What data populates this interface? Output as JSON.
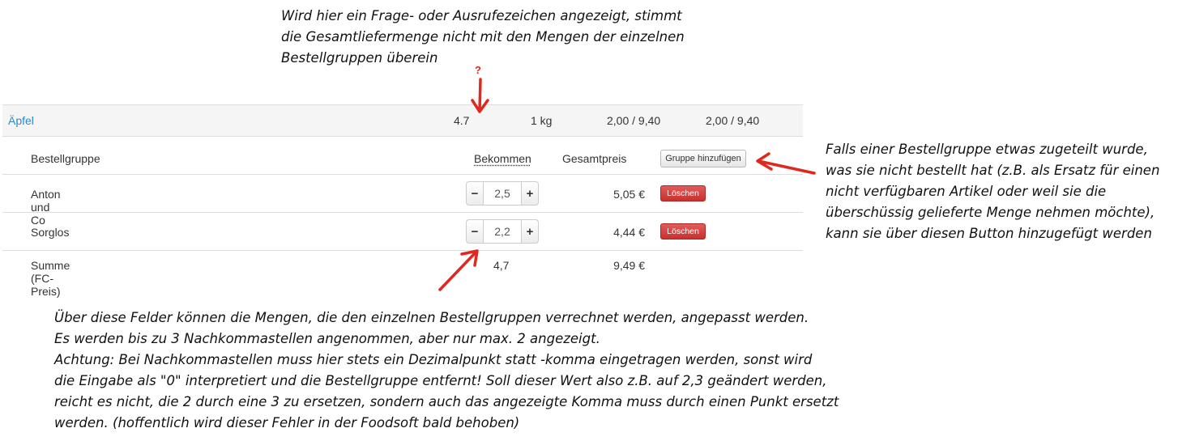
{
  "notes": {
    "top": [
      "Wird hier ein Frage- oder Ausrufezeichen angezeigt, stimmt",
      "die Gesamtliefermenge nicht mit den Mengen der einzelnen",
      "Bestellgruppen überein"
    ],
    "right": [
      "Falls einer Bestellgruppe etwas zugeteilt wurde,",
      "was sie nicht bestellt hat (z.B. als Ersatz für einen",
      "nicht verfügbaren Artikel oder weil sie die",
      "überschüssig gelieferte Menge nehmen möchte),",
      "kann sie über diesen Button hinzugefügt werden"
    ],
    "bottom": [
      "Über diese Felder können die Mengen, die den einzelnen Bestellgruppen verrechnet werden, angepasst werden.",
      "Es werden bis zu 3 Nachkommastellen angenommen, aber nur max. 2 angezeigt.",
      "Achtung: Bei Nachkommastellen muss hier stets ein Dezimalpunkt statt -komma eingetragen werden, sonst wird",
      "die Eingabe als \"0\" interpretiert und die Bestellgruppe entfernt! Soll dieser Wert also z.B. auf 2,3 geändert werden,",
      "reicht es nicht, die 2 durch eine 3 zu ersetzen, sondern auch das angezeigte Komma muss durch einen Punkt ersetzt",
      "werden. (hoffentlich wird dieser Fehler in der Foodsoft bald behoben)"
    ]
  },
  "mismatch_indicator": "?",
  "article": {
    "name": "Äpfel",
    "received": "4.7",
    "unit": "1 kg",
    "price_a": "2,00 / 9,40",
    "price_b": "2,00 / 9,40"
  },
  "group_table": {
    "header": {
      "name": "Bestellgruppe",
      "received": "Bekommen",
      "total": "Gesamtpreis",
      "add_button": "Gruppe hinzufügen"
    },
    "rows": [
      {
        "name": "Anton und Co",
        "value": "2,5",
        "price": "5,05 €",
        "delete": "Löschen"
      },
      {
        "name": "Sorglos",
        "value": "2,2",
        "price": "4,44 €",
        "delete": "Löschen"
      }
    ],
    "sum": {
      "label": "Summe (FC-Preis)",
      "received": "4,7",
      "price": "9,49 €"
    },
    "stepper_minus": "−",
    "stepper_plus": "+"
  },
  "colors": {
    "annotation_arrow": "#e0281e",
    "link": "#2a8bcc",
    "danger_button": "#c9302c"
  }
}
